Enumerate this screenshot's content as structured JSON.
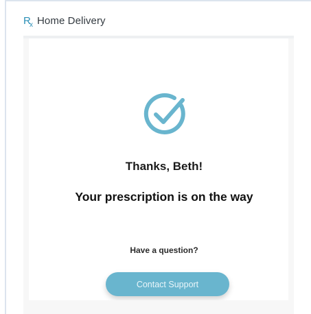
{
  "brand": {
    "rx_r": "R",
    "rx_x": "x",
    "name": "Home Delivery"
  },
  "confirmation": {
    "icon": "check-circle-icon",
    "thanks_text": "Thanks, Beth!",
    "status_text": "Your prescription is on the way"
  },
  "support": {
    "question_text": "Have a question?",
    "contact_label": "Contact Support"
  },
  "colors": {
    "accent": "#69b5ce",
    "brand_teal": "#2b8fb6",
    "text_dark": "#111111"
  }
}
